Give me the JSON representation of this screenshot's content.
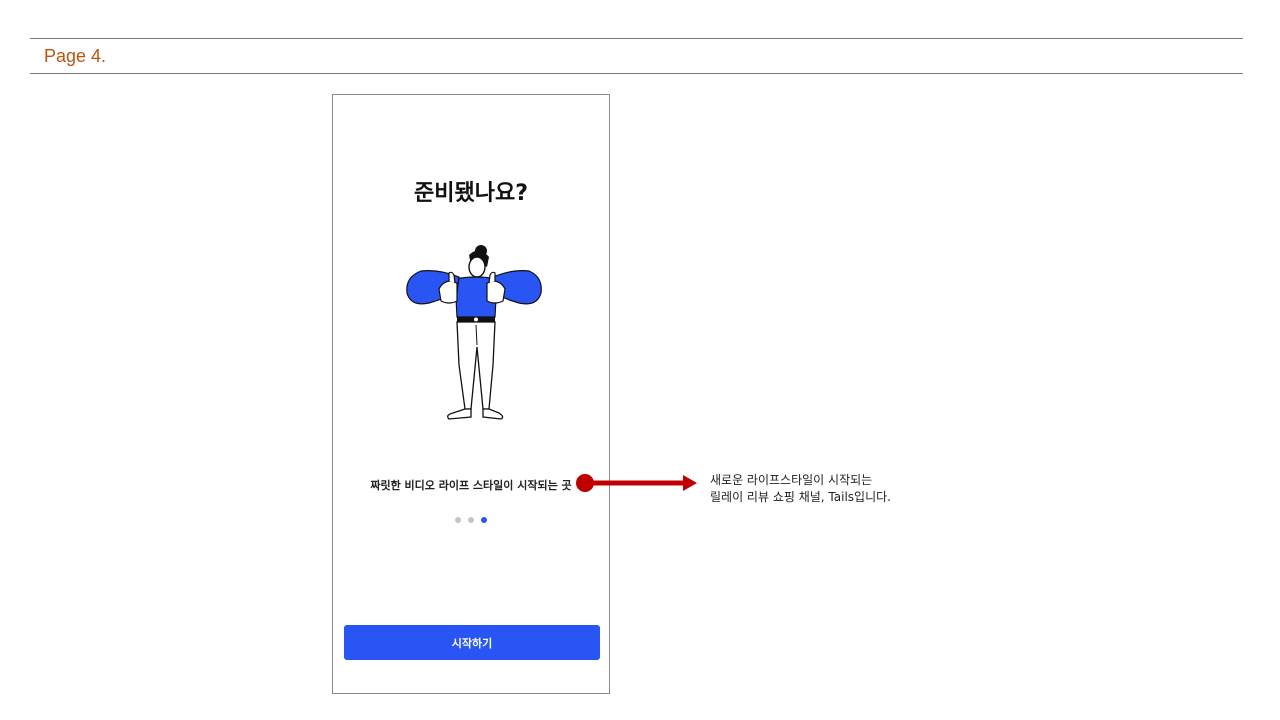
{
  "page_label": "Page 4.",
  "phone": {
    "title": "준비됐나요?",
    "illustration": "woman-thumbs-up-illustration",
    "tagline": "짜릿한 비디오 라이프 스타일이 시작되는 곳",
    "pagination": {
      "total": 3,
      "active": 3
    },
    "start_button_label": "시작하기"
  },
  "annotation": {
    "line1": "새로운 라이프스타일이 시작되는",
    "line2": "릴레이 리뷰 쇼핑 채널, Tails입니다."
  },
  "colors": {
    "accent": "#2a55f5",
    "page_label": "#b8560f",
    "callout": "#c00000",
    "dot_inactive": "#c4c4c4"
  }
}
